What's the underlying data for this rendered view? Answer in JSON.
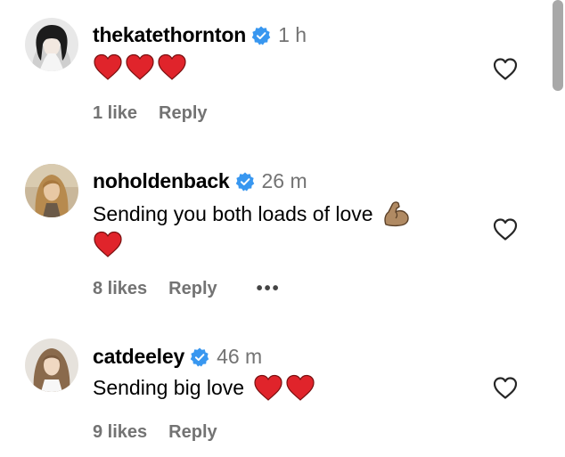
{
  "comments": [
    {
      "username": "thekatethornton",
      "time": "1 h",
      "text": "",
      "likes": "1 like",
      "reply": "Reply",
      "avatar_icon": "avatar-blonde-bob",
      "body_emoji": [
        "red-heart",
        "red-heart",
        "red-heart"
      ]
    },
    {
      "username": "noholdenback",
      "time": "26 m",
      "text": "Sending you both loads of love",
      "likes": "8 likes",
      "reply": "Reply",
      "more": "•••",
      "avatar_icon": "avatar-long-hair",
      "body_emoji": [
        "flexed-biceps",
        "red-heart"
      ]
    },
    {
      "username": "catdeeley",
      "time": "46 m",
      "text": "Sending big love",
      "likes": "9 likes",
      "reply": "Reply",
      "avatar_icon": "avatar-light-hair",
      "body_emoji": [
        "red-heart",
        "red-heart"
      ]
    }
  ],
  "colors": {
    "verified": "#3897f0",
    "heart": "#e0242b",
    "muted_text": "#737373"
  }
}
